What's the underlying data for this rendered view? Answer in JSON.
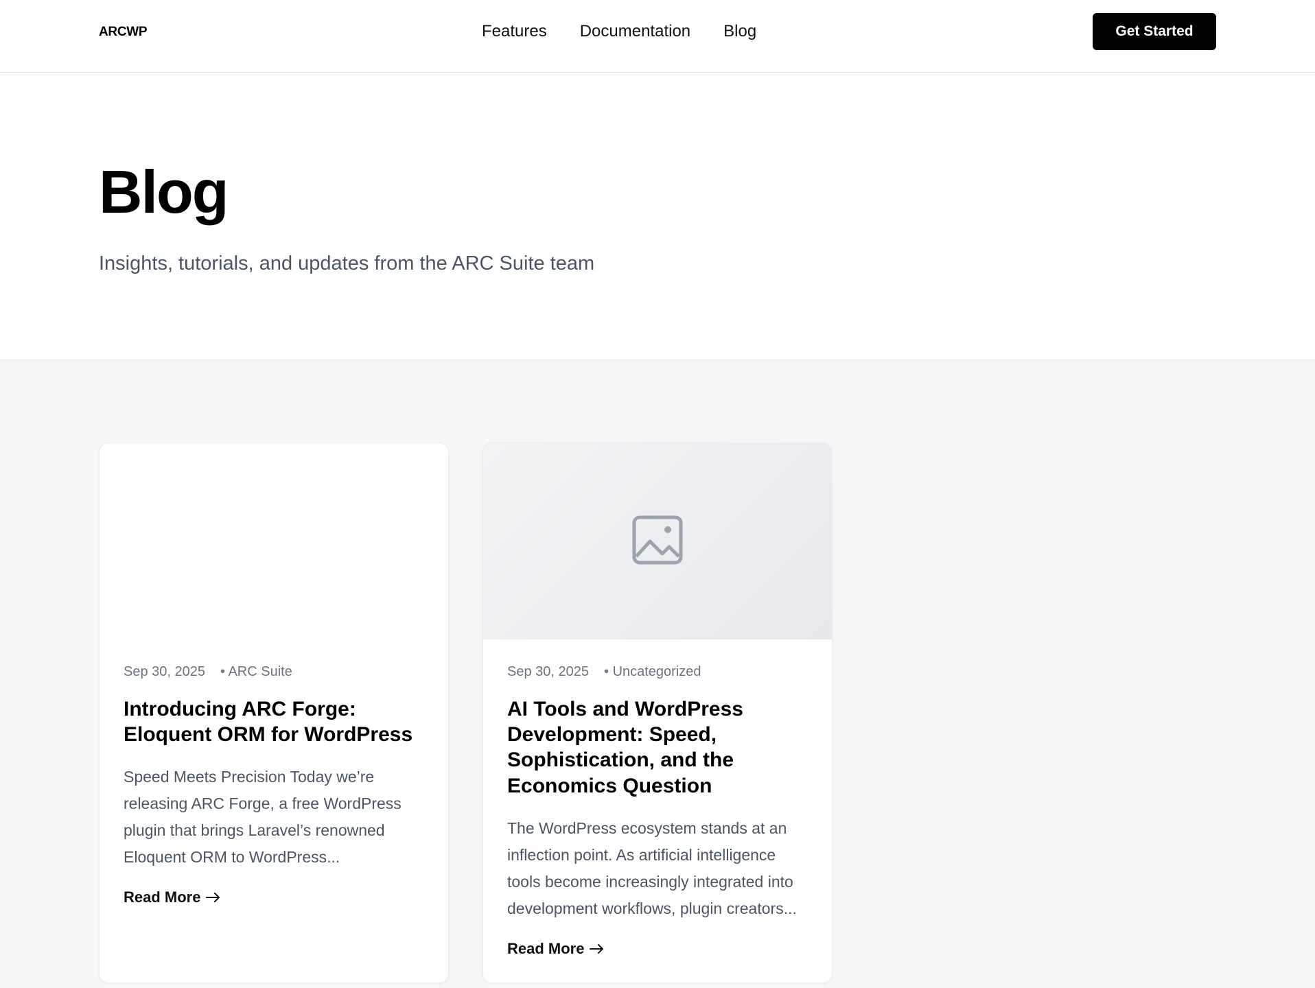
{
  "header": {
    "logo": "ARCWP",
    "nav": [
      "Features",
      "Documentation",
      "Blog"
    ],
    "cta": "Get Started"
  },
  "hero": {
    "title": "Blog",
    "subtitle": "Insights, tutorials, and updates from the ARC Suite team"
  },
  "posts": [
    {
      "date": "Sep 30, 2025",
      "category": "ARC Suite",
      "title": "Introducing ARC Forge: Eloquent ORM for WordPress",
      "excerpt": "Speed Meets Precision Today we’re releasing ARC Forge, a free WordPress plugin that brings Laravel’s renowned Eloquent ORM to WordPress...",
      "read_more": "Read More",
      "has_image_placeholder": false
    },
    {
      "date": "Sep 30, 2025",
      "category": "Uncategorized",
      "title": "AI Tools and WordPress Development: Speed, Sophistication, and the Economics Question",
      "excerpt": "The WordPress ecosystem stands at an inflection point. As artificial intelligence tools become increasingly integrated into development workflows, plugin creators...",
      "read_more": "Read More",
      "has_image_placeholder": true,
      "image_icon": "image-icon"
    }
  ],
  "colors": {
    "cta_bg": "#000000",
    "posts_bg": "#f7f7f9",
    "muted_text": "#4b5563",
    "meta_text": "#6b7280"
  }
}
